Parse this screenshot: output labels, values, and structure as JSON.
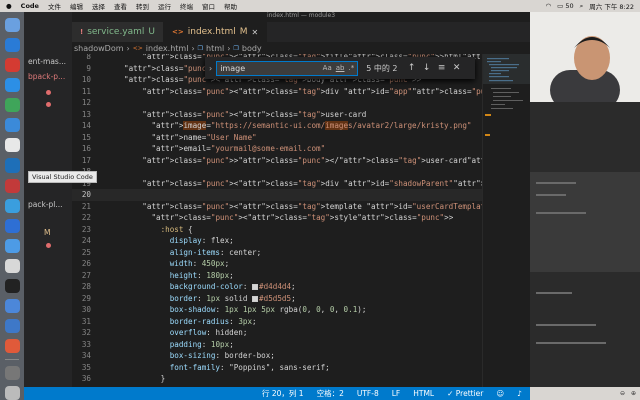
{
  "menubar": {
    "app": "Code",
    "items": [
      "文件",
      "编辑",
      "选择",
      "查看",
      "转到",
      "运行",
      "终端",
      "窗口",
      "帮助"
    ],
    "battery": "50",
    "datetime": "周六 下午 8:22"
  },
  "window_title": "index.html — module3",
  "tooltip": "Visual Studio Code",
  "explorer": {
    "items": [
      {
        "label": "ent-mas...",
        "mark": ""
      },
      {
        "label": "bpack-p...",
        "mark": ""
      },
      {
        "label": "pack-pl...",
        "mark": ""
      },
      {
        "label": "",
        "mark": "M"
      }
    ]
  },
  "tabs": [
    {
      "ext": "!",
      "label": "service.yaml",
      "status": "U",
      "active": false
    },
    {
      "ext": "<>",
      "label": "index.html",
      "status": "M",
      "active": true
    }
  ],
  "breadcrumb": [
    "shadowDom",
    "index.html",
    "html",
    "body"
  ],
  "find": {
    "query": "image",
    "count": "5 中的 2",
    "options": [
      "Aa",
      "ab",
      ".*"
    ]
  },
  "editor": {
    "lines": [
      {
        "n": "8",
        "text": "    <title>html</title>"
      },
      {
        "n": "9",
        "text": "</head>"
      },
      {
        "n": "10",
        "text": "<body>"
      },
      {
        "n": "11",
        "text": "    <div id=\"app\"></div>"
      },
      {
        "n": "12",
        "text": ""
      },
      {
        "n": "13",
        "text": "    <user-card"
      },
      {
        "n": "14",
        "text": "      image=\"https://semantic-ui.com/images/avatar2/large/kristy.png\""
      },
      {
        "n": "15",
        "text": "      name=\"User Name\""
      },
      {
        "n": "16",
        "text": "      email=\"yourmail@some-email.com\""
      },
      {
        "n": "17",
        "text": "    ></user-card>"
      },
      {
        "n": "18",
        "text": ""
      },
      {
        "n": "19",
        "text": "    <div id=\"shadowParent\"></div>"
      },
      {
        "n": "20",
        "text": ""
      },
      {
        "n": "21",
        "text": "    <template id=\"userCardTemplate\">"
      },
      {
        "n": "22",
        "text": "      <style>"
      },
      {
        "n": "23",
        "text": "        :host {"
      },
      {
        "n": "24",
        "text": "          display: flex;"
      },
      {
        "n": "25",
        "text": "          align-items: center;"
      },
      {
        "n": "26",
        "text": "          width: 450px;"
      },
      {
        "n": "27",
        "text": "          height: 180px;"
      },
      {
        "n": "28",
        "text": "          background-color: #d4d4d4;"
      },
      {
        "n": "29",
        "text": "          border: 1px solid #d5d5d5;"
      },
      {
        "n": "30",
        "text": "          box-shadow: 1px 1px 5px rgba(0, 0, 0, 0.1);"
      },
      {
        "n": "31",
        "text": "          border-radius: 3px;"
      },
      {
        "n": "32",
        "text": "          overflow: hidden;"
      },
      {
        "n": "33",
        "text": "          padding: 10px;"
      },
      {
        "n": "34",
        "text": "          box-sizing: border-box;"
      },
      {
        "n": "35",
        "text": "          font-family: \"Poppins\", sans-serif;"
      },
      {
        "n": "36",
        "text": "        }"
      }
    ]
  },
  "status": {
    "position": "行 20，列 1",
    "spaces": "空格：2",
    "encoding": "UTF-8",
    "eol": "LF",
    "language": "HTML",
    "formatter": "✓ Prettier"
  },
  "colors": {
    "accent": "#007acc",
    "tag": "#569cd6",
    "attr": "#9cdcfe",
    "string": "#ce9178",
    "swatch1": "#d4d4d4",
    "swatch2": "#d5d5d5"
  }
}
